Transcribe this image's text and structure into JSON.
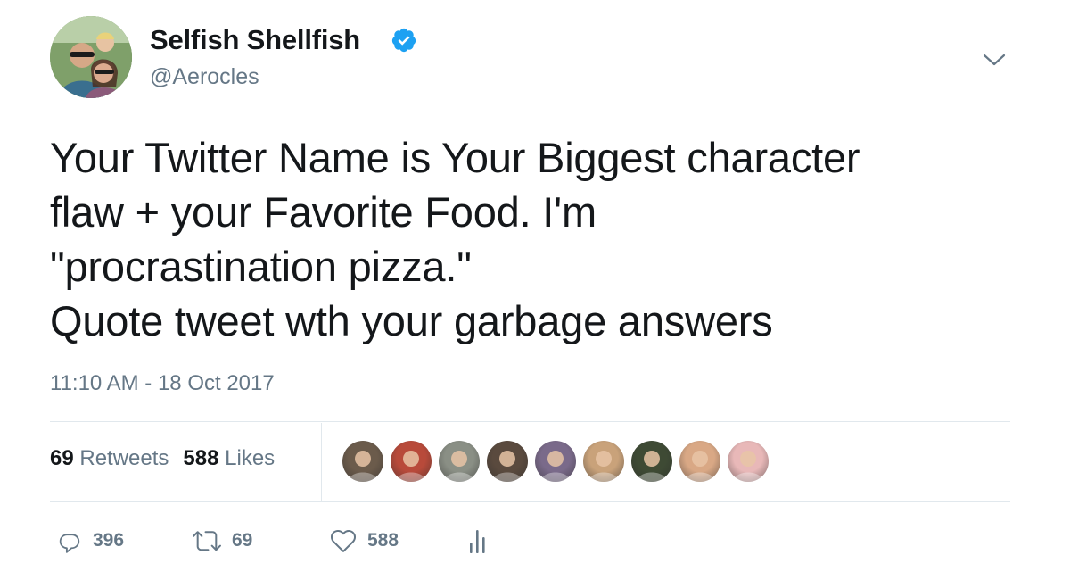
{
  "tweet": {
    "author": {
      "name": "Selfish Shellfish",
      "handle": "@Aerocles",
      "verified": true
    },
    "text": "Your Twitter Name is Your Biggest character\nflaw + your Favorite Food. I'm\n\"procrastination pizza.\"\nQuote tweet wth your garbage answers",
    "timestamp": "11:10 AM - 18 Oct 2017",
    "stats": {
      "retweets_count": "69",
      "retweets_label": "Retweets",
      "likes_count": "588",
      "likes_label": "Likes"
    },
    "likers": [
      {
        "name": "liker-1",
        "color": "#6b5b4b"
      },
      {
        "name": "liker-2",
        "color": "#b84a3a"
      },
      {
        "name": "liker-3",
        "color": "#8a8f85"
      },
      {
        "name": "liker-4",
        "color": "#5a4a3e"
      },
      {
        "name": "liker-5",
        "color": "#7a6a8a"
      },
      {
        "name": "liker-6",
        "color": "#c9a27a"
      },
      {
        "name": "liker-7",
        "color": "#3e4a34"
      },
      {
        "name": "liker-8",
        "color": "#d9a885"
      },
      {
        "name": "liker-9",
        "color": "#e8b8b8"
      }
    ],
    "actions": {
      "reply_count": "396",
      "retweet_count": "69",
      "like_count": "588"
    },
    "icons": {
      "verified": "verified-badge-icon",
      "caret": "chevron-down-icon",
      "reply": "reply-icon",
      "retweet": "retweet-icon",
      "like": "heart-icon",
      "analytics": "analytics-icon"
    },
    "colors": {
      "text": "#14171a",
      "secondary": "#657786",
      "verified_blue": "#1da1f2",
      "divider": "#e1e8ed"
    }
  }
}
